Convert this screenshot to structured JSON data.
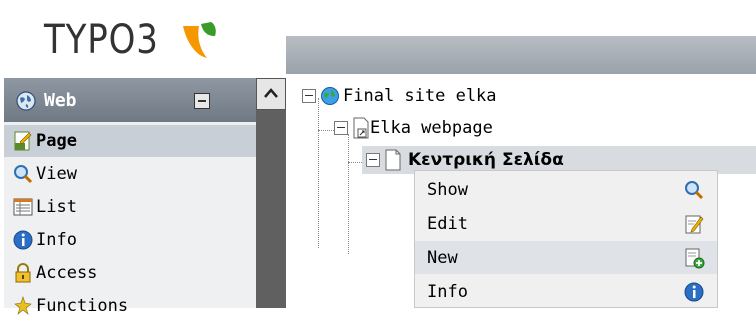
{
  "logo": {
    "text": "TYPO3"
  },
  "module_menu": {
    "group": {
      "label": "Web",
      "icon": "globe-icon"
    },
    "items": [
      {
        "label": "Page",
        "icon": "page-icon",
        "active": true
      },
      {
        "label": "View",
        "icon": "magnifier-icon",
        "active": false
      },
      {
        "label": "List",
        "icon": "list-icon",
        "active": false
      },
      {
        "label": "Info",
        "icon": "info-icon",
        "active": false
      },
      {
        "label": "Access",
        "icon": "lock-icon",
        "active": false
      },
      {
        "label": "Functions",
        "icon": "functions-icon",
        "active": false
      }
    ]
  },
  "page_tree": {
    "nodes": [
      {
        "label": "Final site elka",
        "icon": "globe-icon"
      },
      {
        "label": "Elka webpage",
        "icon": "shortcut-page-icon"
      },
      {
        "label": "Κεντρική Σελίδα",
        "icon": "page-icon",
        "selected": true
      }
    ]
  },
  "context_menu": {
    "items": [
      {
        "label": "Show",
        "icon": "magnifier-icon"
      },
      {
        "label": "Edit",
        "icon": "edit-icon"
      },
      {
        "label": "New",
        "icon": "new-page-icon",
        "hover": true
      },
      {
        "label": "Info",
        "icon": "info-icon"
      }
    ]
  },
  "colors": {
    "header_bar": "#9aa2aa",
    "menu_active": "#c9cfd6",
    "typo3_orange": "#f49700"
  }
}
